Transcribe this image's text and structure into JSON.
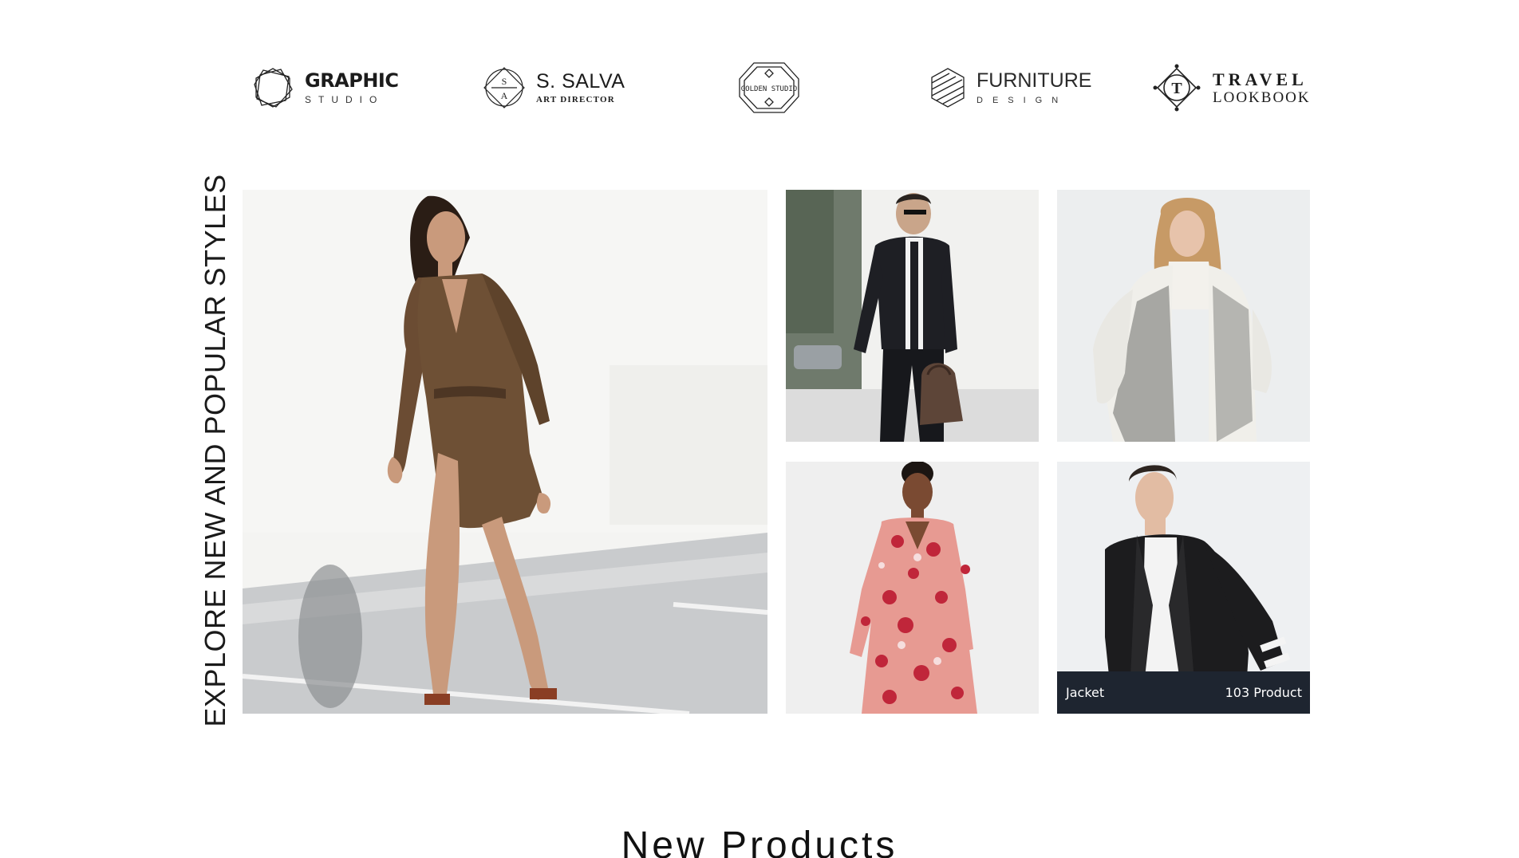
{
  "brands": [
    {
      "name": "GRAPHIC",
      "sub": "STUDIO",
      "icon": "hexagon-logo-icon"
    },
    {
      "name": "S. SALVA",
      "sub": "ART DIRECTOR",
      "monogram_top": "S",
      "monogram_bottom": "A",
      "icon": "diamond-circle-logo-icon"
    },
    {
      "name": "GOLDEN STUDIO",
      "icon": "octagon-badge-logo-icon"
    },
    {
      "name": "FURNITURE",
      "sub": "DESIGN",
      "icon": "striped-cube-logo-icon"
    },
    {
      "name": "TRAVEL",
      "sub": "LOOKBOOK",
      "monogram": "T",
      "icon": "diamond-t-logo-icon"
    }
  ],
  "explore": {
    "vertical_title": "EXPLORE NEW AND POPULAR STYLES"
  },
  "gallery": {
    "tiles": [
      {
        "subject": "woman-brown-dress-walking"
      },
      {
        "subject": "man-black-jacket-bag"
      },
      {
        "subject": "woman-white-knit-vest"
      },
      {
        "subject": "woman-floral-dress"
      },
      {
        "subject": "man-black-cardigan",
        "caption": {
          "label": "Jacket",
          "count": "103 Product"
        }
      }
    ]
  },
  "colors": {
    "caption_bar": "#1e2530",
    "text": "#111111",
    "background": "#ffffff"
  },
  "sections": {
    "new_products_title": "New Products"
  }
}
